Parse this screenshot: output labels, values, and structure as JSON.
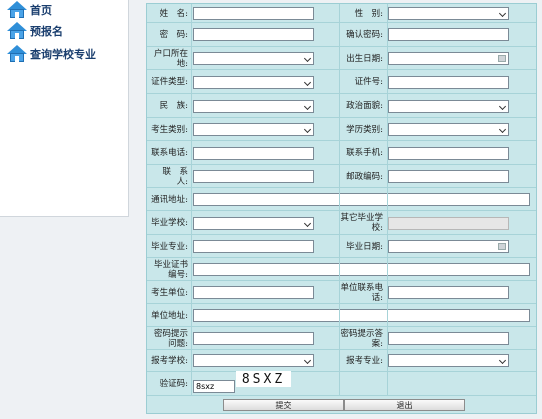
{
  "sidebar": {
    "items": [
      {
        "label": "首页",
        "icon": "home-icon"
      },
      {
        "label": "预报名",
        "icon": "home-icon"
      },
      {
        "label": "查询学校专业",
        "icon": "home-icon"
      }
    ]
  },
  "form": {
    "name_label": "姓　名:",
    "gender_label": "性　别:",
    "password_label": "密　码:",
    "confirm_password_label": "确认密码:",
    "household_label": "户口所在地:",
    "birth_date_label": "出生日期:",
    "id_type_label": "证件类型:",
    "id_number_label": "证件号:",
    "ethnicity_label": "民　族:",
    "politics_label": "政治面貌:",
    "candidate_type_label": "考生类别:",
    "education_type_label": "学历类别:",
    "phone_label": "联系电话:",
    "mobile_label": "联系手机:",
    "contact_label": "联　系　人:",
    "postal_label": "邮政编码:",
    "address_label": "通讯地址:",
    "grad_school_label": "毕业学校:",
    "other_school_label": "其它毕业学校:",
    "grad_major_label": "毕业专业:",
    "grad_date_label": "毕业日期:",
    "cert_number_label": "毕业证书编号:",
    "employer_label": "考生单位:",
    "employer_phone_label": "单位联系电话:",
    "employer_address_label": "单位地址:",
    "hint_question_label": "密码提示问题:",
    "hint_answer_label": "密码提示答案:",
    "apply_school_label": "报考学校:",
    "apply_major_label": "报考专业:",
    "captcha_label": "验证码:",
    "captcha_value": "8sxz",
    "captcha_image_text": "8SXZ",
    "submit_label": "提交",
    "exit_label": "退出"
  }
}
